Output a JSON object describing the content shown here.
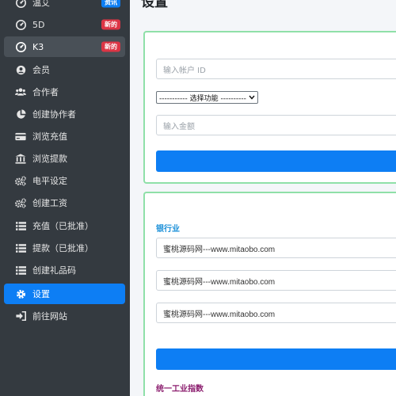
{
  "sidebar": {
    "items": [
      {
        "label": "温艾",
        "icon": "gauge-icon",
        "badge": "资讯",
        "badge_color": "#0d7ef4"
      },
      {
        "label": "5D",
        "icon": "gauge-icon",
        "badge": "新的",
        "badge_color": "#dc3545"
      },
      {
        "label": "K3",
        "icon": "gauge-icon",
        "badge": "新的",
        "badge_color": "#dc3545"
      },
      {
        "label": "会员",
        "icon": "user-circle-icon"
      },
      {
        "label": "合作者",
        "icon": "users-icon"
      },
      {
        "label": "创建协作者",
        "icon": "pie-chart-icon"
      },
      {
        "label": "浏览充值",
        "icon": "credit-card-icon"
      },
      {
        "label": "浏览提款",
        "icon": "bank-icon"
      },
      {
        "label": "电平设定",
        "icon": "gears-icon"
      },
      {
        "label": "创建工资",
        "icon": "gears-icon"
      },
      {
        "label": "充值（已批准）",
        "icon": "list-icon"
      },
      {
        "label": "提款（已批准）",
        "icon": "list-icon"
      },
      {
        "label": "创建礼品码",
        "icon": "list-icon"
      },
      {
        "label": "设置",
        "icon": "gear-icon"
      },
      {
        "label": "前往网站",
        "icon": "sign-in-icon"
      }
    ]
  },
  "main": {
    "title": "设置",
    "form1": {
      "account_placeholder": "输入帐户 ID",
      "select_value": "----------- 选择功能 ----------",
      "amount_placeholder": "输入金额"
    },
    "form2": {
      "bank_label": "银行业",
      "bank_values": [
        "蜜桃源码网---www.mitaobo.com",
        "蜜桃源码网---www.mitaobo.com",
        "蜜桃源码网---www.mitaobo.com"
      ],
      "industry_label": "统一工业指数"
    }
  },
  "colors": {
    "sidebar_bg": "#343a40",
    "accent": "#0d7ef4",
    "badge_new": "#dc3545",
    "card_border": "#8fe0a8",
    "bank_label": "#1a8fd8",
    "industry_label": "#8b1d6e"
  }
}
